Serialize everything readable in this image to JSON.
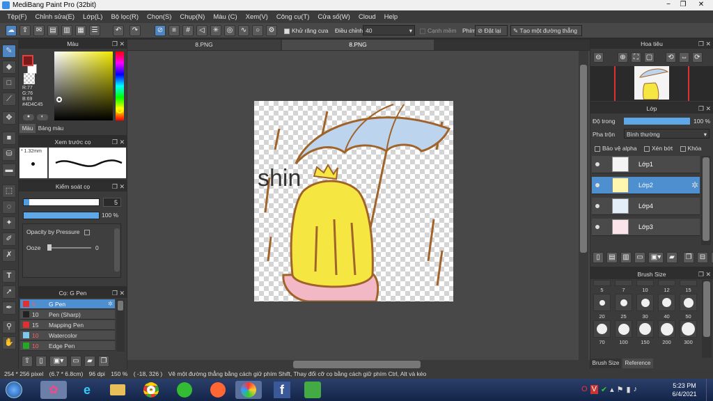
{
  "title": "MediBang Paint Pro (32bit)",
  "window_buttons": {
    "min": "−",
    "max": "❐",
    "close": "✕"
  },
  "menu": [
    "Tệp(F)",
    "Chỉnh sửa(E)",
    "Lớp(L)",
    "Bộ lọc(R)",
    "Chọn(S)",
    "Chụp(N)",
    "Màu (C)",
    "Xem(V)",
    "Công cụ(T)",
    "Cửa số(W)",
    "Cloud",
    "Help"
  ],
  "toolbar": {
    "antialias": "Khử răng cưa",
    "correction_label": "Điều chỉnh",
    "correction_value": "40",
    "edge": "Cạnh mềm",
    "key_label": "Phím",
    "reset": "Đặt lại",
    "straight_line": "Tạo một đường thẳng"
  },
  "tabs": [
    "8.PNG",
    "8.PNG"
  ],
  "color_panel": {
    "title": "Màu",
    "r": "R:77",
    "g": "G:76",
    "b": "B:69",
    "hex": "#4D4C45",
    "tab_color": "Màu",
    "tab_palette": "Bảng màu",
    "fg": "#c0392b",
    "bg": "#ffffff"
  },
  "preview_panel": {
    "title": "Xem trước cọ",
    "size": "1.32mm"
  },
  "brush_control": {
    "title": "Kiểm soát cọ",
    "size_value": "5",
    "opacity_value": "100 %",
    "opacity_pressure": "Opacity by Pressure",
    "ooze_label": "Ooze",
    "ooze_value": "0"
  },
  "brush_panel": {
    "title": "Cọ: G Pen",
    "items": [
      {
        "size": "5",
        "name": "G Pen",
        "color": "#e03030",
        "selected": true
      },
      {
        "size": "10",
        "name": "Pen (Sharp)",
        "color": "#222222",
        "selected": false
      },
      {
        "size": "15",
        "name": "Mapping Pen",
        "color": "#e03030",
        "selected": false
      },
      {
        "size": "10",
        "name": "Watercolor",
        "color": "#7fc8f0",
        "selected": false
      },
      {
        "size": "10",
        "name": "Edge Pen",
        "color": "#22aa22",
        "selected": false
      }
    ]
  },
  "canvas": {
    "text": "shin"
  },
  "navigator": {
    "title": "Hoa tiêu"
  },
  "layer_panel": {
    "title": "Lớp",
    "opacity_label": "Độ trong",
    "opacity_value": "100 %",
    "blend_label": "Pha trộn",
    "blend_value": "Bình thường",
    "protect_alpha": "Bảo vệ alpha",
    "clipping": "Xén bớt",
    "lock": "Khóa",
    "layers": [
      {
        "name": "Lớp1",
        "selected": false
      },
      {
        "name": "Lớp2",
        "selected": true
      },
      {
        "name": "Lớp4",
        "selected": false
      },
      {
        "name": "Lớp3",
        "selected": false
      }
    ]
  },
  "brush_size": {
    "title": "Brush Size",
    "sizes": [
      "5",
      "7",
      "10",
      "12",
      "15",
      "20",
      "25",
      "30",
      "40",
      "50",
      "70",
      "100",
      "150",
      "200",
      "300"
    ],
    "tab1": "Brush Size",
    "tab2": "Reference"
  },
  "status": {
    "dims": "254 * 256 pixel",
    "physical": "(6.7 * 6.8cm)",
    "dpi": "96 dpi",
    "zoom": "150 %",
    "coords": "( -18, 326 )",
    "hint": "Vẽ một đường thẳng bằng cách giữ phím Shift, Thay đổi cỡ cọ bằng cách giữ phím Ctrl, Alt và kéo"
  },
  "clock": {
    "time": "5:23 PM",
    "date": "6/4/2021"
  }
}
